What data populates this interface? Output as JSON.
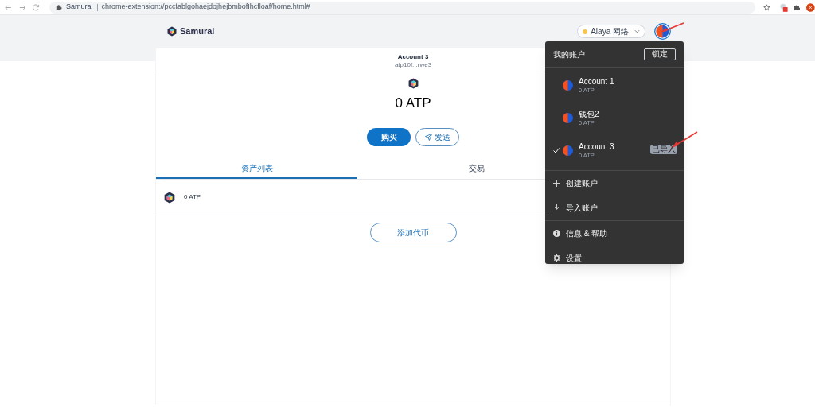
{
  "browser": {
    "site_name": "Samurai",
    "url": "chrome-extension://pccfablgohaejdojhejbmbofIhcfloaf/home.html#"
  },
  "header": {
    "brand": "Samurai",
    "network": "Alaya 网络"
  },
  "account": {
    "name": "Account 3",
    "address": "atp10f...rwe3"
  },
  "balance": "0 ATP",
  "actions": [
    {
      "label": "购买",
      "kind": "primary"
    },
    {
      "label": "发送",
      "kind": "send"
    }
  ],
  "tabs": [
    {
      "label": "资产列表",
      "selected": true
    },
    {
      "label": "交易",
      "selected": false
    }
  ],
  "assets": [
    {
      "amount": "0 ATP"
    }
  ],
  "add_token_button": "添加代币",
  "menu": {
    "title": "我的账户",
    "lock_button": "锁定",
    "accounts": [
      {
        "name": "Account 1",
        "balance": "0 ATP",
        "selected": false
      },
      {
        "name": "钱包2",
        "balance": "0 ATP",
        "selected": false
      },
      {
        "name": "Account 3",
        "balance": "0 ATP",
        "selected": true,
        "badge": "已导入"
      }
    ],
    "item_groups": [
      [
        {
          "label": "创建账户",
          "kind": "create"
        },
        {
          "label": "导入账户",
          "kind": "import"
        }
      ],
      [
        {
          "label": "信息 & 帮助",
          "kind": "info"
        },
        {
          "label": "设置",
          "kind": "settings"
        }
      ]
    ]
  }
}
